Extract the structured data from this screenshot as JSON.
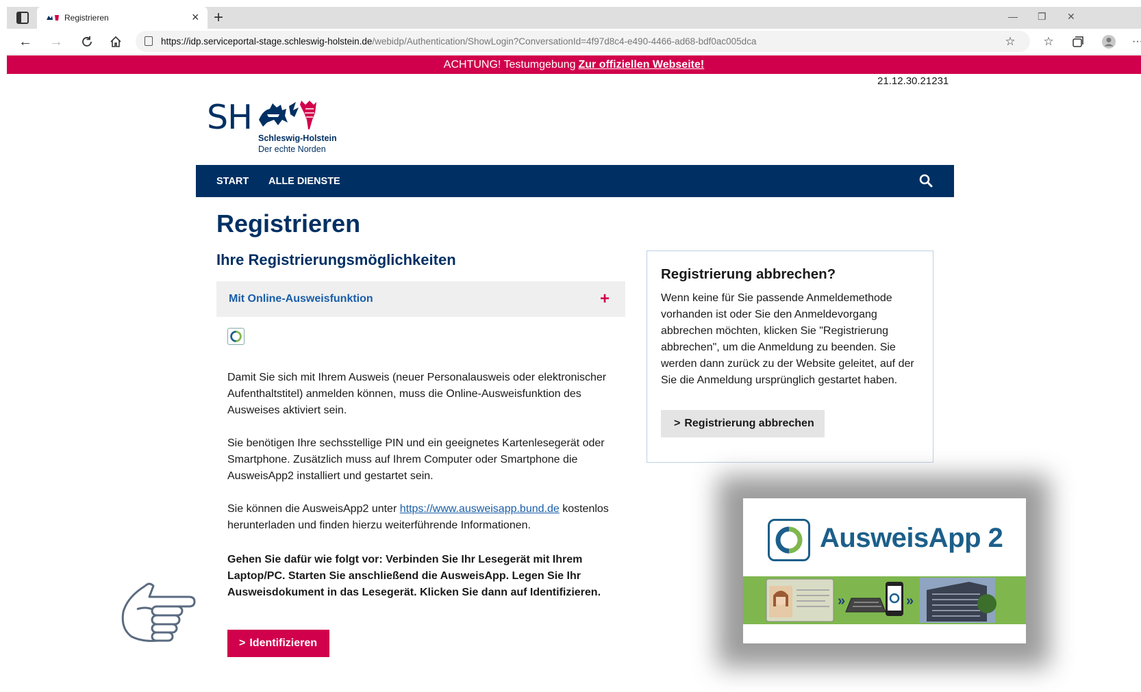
{
  "browser": {
    "tab_title": "Registrieren",
    "tab_close": "×",
    "new_tab": "+",
    "url_host": "https://idp.serviceportal-stage.schleswig-holstein.de",
    "url_path": "/webidp/Authentication/ShowLogin?ConversationId=4f97d8c4-e490-4466-ad68-bdf0ac005dca",
    "window_controls": {
      "minimize": "—",
      "restore": "❐",
      "close": "✕"
    }
  },
  "banner": {
    "text": "ACHTUNG! Testumgebung",
    "link": "Zur offiziellen Webseite!",
    "color": "#d1004c"
  },
  "version": "21.12.30.21231",
  "logo": {
    "abbr": "SH",
    "name": "Schleswig-Holstein",
    "tagline": "Der echte Norden"
  },
  "nav": {
    "items": [
      "START",
      "ALLE DIENSTE"
    ],
    "color": "#003063"
  },
  "main": {
    "title": "Registrieren",
    "subtitle": "Ihre Registrierungsmöglichkeiten",
    "accordion_label": "Mit Online-Ausweisfunktion",
    "accordion_toggle": "+",
    "para1": "Damit Sie sich mit Ihrem Ausweis (neuer Personalausweis oder elektronischer Aufenthaltstitel) anmelden können, muss die Online-Ausweisfunktion des Ausweises aktiviert sein.",
    "para2": "Sie benötigen Ihre sechsstellige PIN und ein geeignetes Kartenlesegerät oder Smartphone. Zusätzlich muss auf Ihrem Computer oder Smartphone die AusweisApp2 installiert und gestartet sein.",
    "para3_before": "Sie können die AusweisApp2 unter ",
    "para3_link": "https://www.ausweisapp.bund.de",
    "para3_after": " kostenlos herunterladen und finden hierzu weiterführende Informationen.",
    "para4": "Gehen Sie dafür wie folgt vor: Verbinden Sie Ihr Lesegerät mit Ihrem Laptop/PC. Starten Sie anschließend die AusweisApp. Legen Sie Ihr Ausweisdokument in das Lesegerät. Klicken Sie dann auf Identifizieren.",
    "identify_button": "Identifizieren",
    "accent": "#d1004c"
  },
  "sidebox": {
    "title": "Registrierung abbrechen?",
    "text": "Wenn keine für Sie passende Anmeldemethode vorhanden ist oder Sie den Anmeldevorgang abbrechen möchten, klicken Sie \"Registrierung abbrechen\", um die Anmeldung zu beenden. Sie werden dann zurück zu der Website geleitet, auf der Sie die Anmeldung ursprünglich gestartet haben.",
    "button": "Registrierung abbrechen"
  },
  "app_card": {
    "name": "AusweisApp 2"
  }
}
